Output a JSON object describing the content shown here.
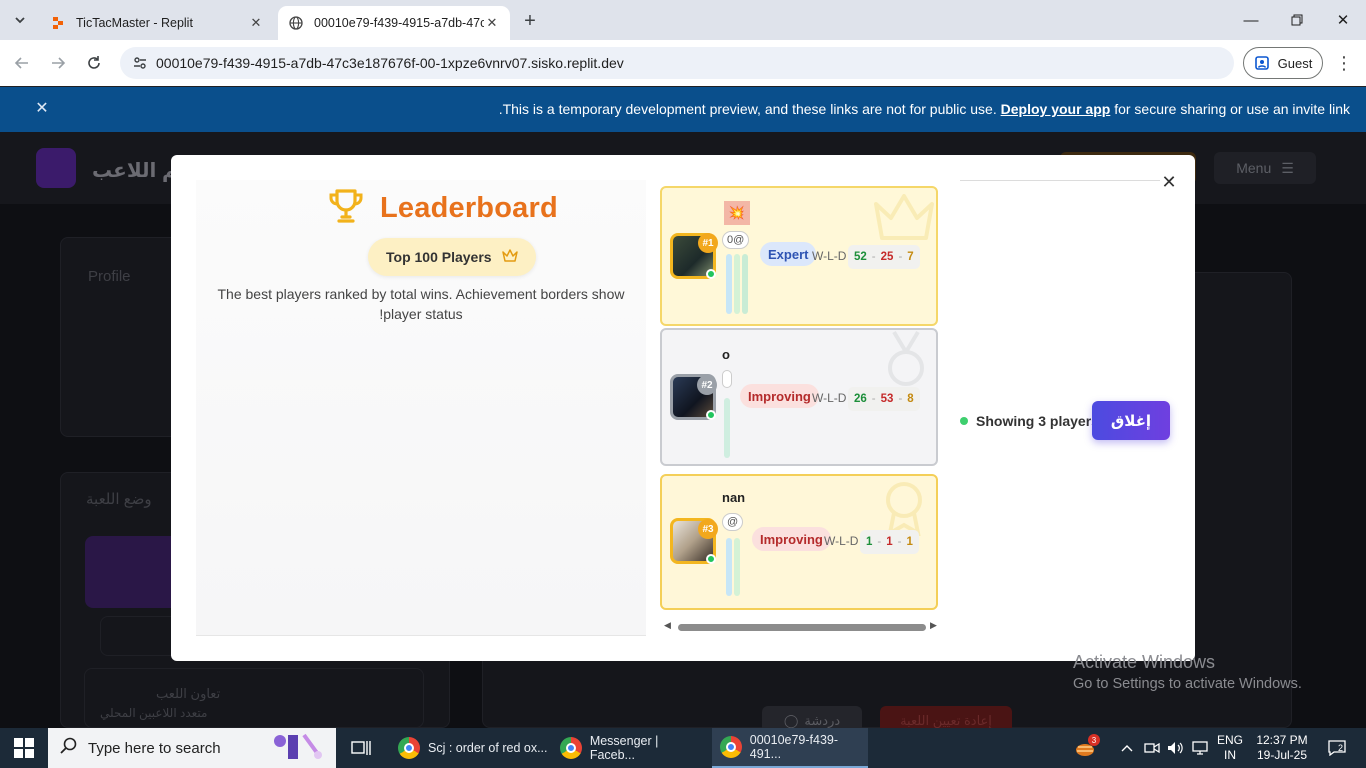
{
  "browser": {
    "tabs": [
      {
        "title": "TicTacMaster - Replit",
        "active": false
      },
      {
        "title": "00010e79-f439-4915-a7db-47c",
        "active": true
      }
    ],
    "url": "00010e79-f439-4915-a7db-47c3e187676f-00-1xpze6vnrv07.sisko.replit.dev",
    "profile_label": "Guest"
  },
  "banner": {
    "text_before": ".This is a temporary development preview, and these links are not for public use. ",
    "link_text": "Deploy your app",
    "text_after": " for secure sharing or use an invite link"
  },
  "app_background": {
    "brand_text": "كم اللاعب",
    "menu_label": "Menu",
    "profile_label": "Profile",
    "mode_label": "وضع اللعبة",
    "coop_title": "تعاون اللعب",
    "coop_sub": "متعدد اللاعبين المحلي",
    "chat_label": "دردشة",
    "reset_label": "إعادة تعيين اللعبة"
  },
  "modal": {
    "title": "Leaderboard",
    "top_pill": "Top 100 Players",
    "description_line1": "The best players ranked by total wins. Achievement borders show",
    "description_line2": "!player status",
    "showing_text": "Showing 3 players",
    "close_button_label": "إغلاق",
    "wld_label": "W-L-D",
    "players": [
      {
        "rank": "#1",
        "name_fragment": "",
        "handle_fragment": "0@",
        "badge": "Expert",
        "wins": "52",
        "losses": "25",
        "draws": "7",
        "tier": "gold"
      },
      {
        "rank": "#2",
        "name_fragment": "o",
        "handle_fragment": "",
        "badge": "Improving",
        "wins": "26",
        "losses": "53",
        "draws": "8",
        "tier": "silver"
      },
      {
        "rank": "#3",
        "name_fragment": "nan",
        "handle_fragment": "@",
        "badge": "Improving",
        "wins": "1",
        "losses": "1",
        "draws": "1",
        "tier": "bronze"
      }
    ]
  },
  "windows": {
    "activate_title": "Activate Windows",
    "activate_sub": "Go to Settings to activate Windows.",
    "search_placeholder": "Type here to search",
    "tasks": [
      "Scj : order of red ox...",
      "Messenger | Faceb...",
      "00010e79-f439-491..."
    ],
    "lang_top": "ENG",
    "lang_bottom": "IN",
    "time": "12:37 PM",
    "date": "19-Jul-25",
    "weather_badge": "3",
    "notif_count": "2"
  },
  "colors": {
    "banner_bg": "#0a4f8c",
    "leaderboard_orange": "#e8721c",
    "close_button": "#5a46e0",
    "online_green": "#22c55e"
  }
}
